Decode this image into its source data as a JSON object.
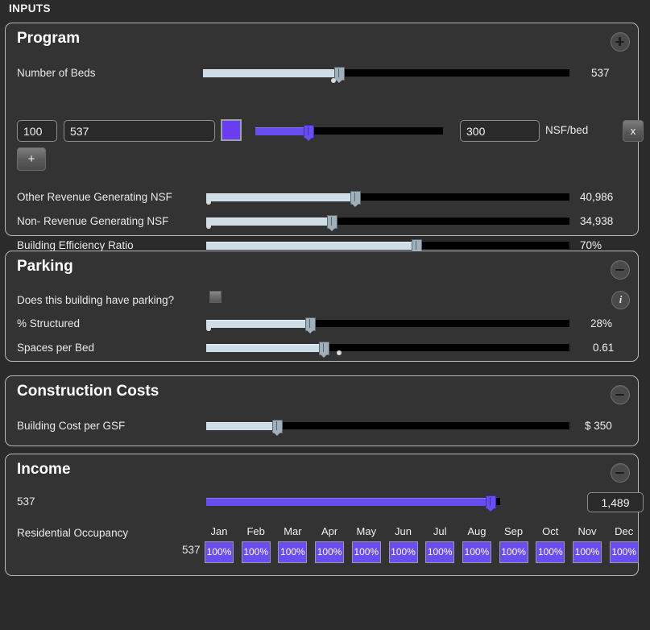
{
  "header": {
    "title": "INPUTS"
  },
  "panels": {
    "program": {
      "title": "Program",
      "toggle_icon": "plus-icon",
      "beds": {
        "label": "Number of Beds",
        "value": "537"
      },
      "component_row": {
        "count_value": "100",
        "name_value": "537",
        "swatch_color": "#6a3df0",
        "nsf_value": "300",
        "nsf_unit": "NSF/bed",
        "remove_label": "x",
        "add_label": "+"
      },
      "rows": [
        {
          "label": "Other Revenue Generating NSF",
          "value": "40,986"
        },
        {
          "label": "Non- Revenue Generating NSF",
          "value": "34,938"
        },
        {
          "label": "Building Efficiency Ratio",
          "value": "70%"
        }
      ]
    },
    "parking": {
      "title": "Parking",
      "toggle_icon": "minus-icon",
      "info_icon": "info-icon",
      "question": {
        "label": "Does this building have parking?",
        "checked": false
      },
      "rows": [
        {
          "label": "% Structured",
          "value": "28%"
        },
        {
          "label": "Spaces per Bed",
          "value": "0.61"
        }
      ]
    },
    "construction": {
      "title": "Construction Costs",
      "toggle_icon": "minus-icon",
      "rows": [
        {
          "label": "Building Cost per GSF",
          "value": "$ 350"
        }
      ]
    },
    "income": {
      "title": "Income",
      "toggle_icon": "minus-icon",
      "rate_row": {
        "label": "537",
        "value": "1,489"
      },
      "occupancy": {
        "label": "Residential Occupancy",
        "row_label": "537",
        "months": [
          "Jan",
          "Feb",
          "Mar",
          "Apr",
          "May",
          "Jun",
          "Jul",
          "Aug",
          "Sep",
          "Oct",
          "Nov",
          "Dec"
        ],
        "values": [
          "100%",
          "100%",
          "100%",
          "100%",
          "100%",
          "100%",
          "100%",
          "100%",
          "100%",
          "100%",
          "100%",
          "100%"
        ]
      }
    }
  }
}
